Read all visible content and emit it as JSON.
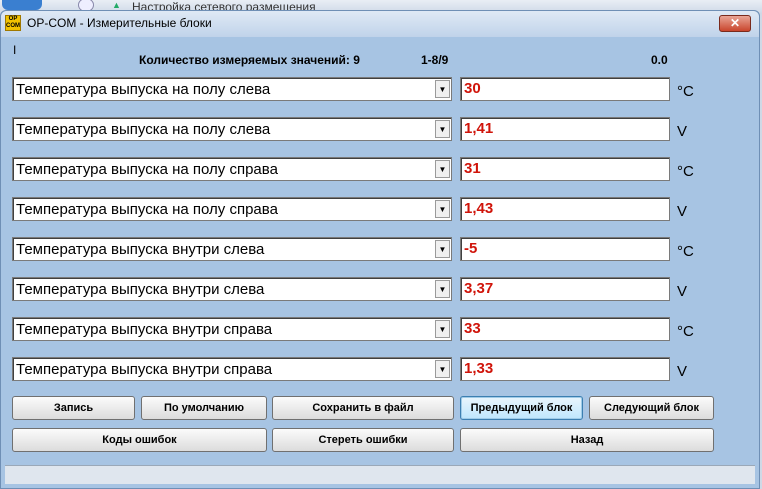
{
  "background": {
    "text": "Настройка сетевого размещения"
  },
  "window": {
    "icon_text": "OP COM",
    "title": "OP-COM - Измерительные блоки",
    "close_label": "✕"
  },
  "header": {
    "cursor": "I",
    "count_label": "Количество измеряемых значений: 9",
    "range": "1-8/9",
    "time": "0.0"
  },
  "rows": [
    {
      "label": "Температура выпуска на полу слева",
      "value": "30",
      "unit": "°C"
    },
    {
      "label": "Температура выпуска на полу слева",
      "value": "1,41",
      "unit": "V"
    },
    {
      "label": "Температура выпуска на полу справа",
      "value": "31",
      "unit": "°C"
    },
    {
      "label": "Температура выпуска на полу справа",
      "value": "1,43",
      "unit": "V"
    },
    {
      "label": "Температура выпуска внутри слева",
      "value": "-5",
      "unit": "°C"
    },
    {
      "label": "Температура выпуска внутри слева",
      "value": "3,37",
      "unit": "V"
    },
    {
      "label": "Температура выпуска внутри справа",
      "value": "33",
      "unit": "°C"
    },
    {
      "label": "Температура выпуска внутри справа",
      "value": "1,33",
      "unit": "V"
    }
  ],
  "dropdown_glyph": "▼",
  "buttons": {
    "record": "Запись",
    "default": "По умолчанию",
    "save_file": "Сохранить в файл",
    "prev_block": "Предыдущий блок",
    "next_block": "Следующий блок",
    "error_codes": "Коды ошибок",
    "clear_errors": "Стереть ошибки",
    "back": "Назад"
  }
}
